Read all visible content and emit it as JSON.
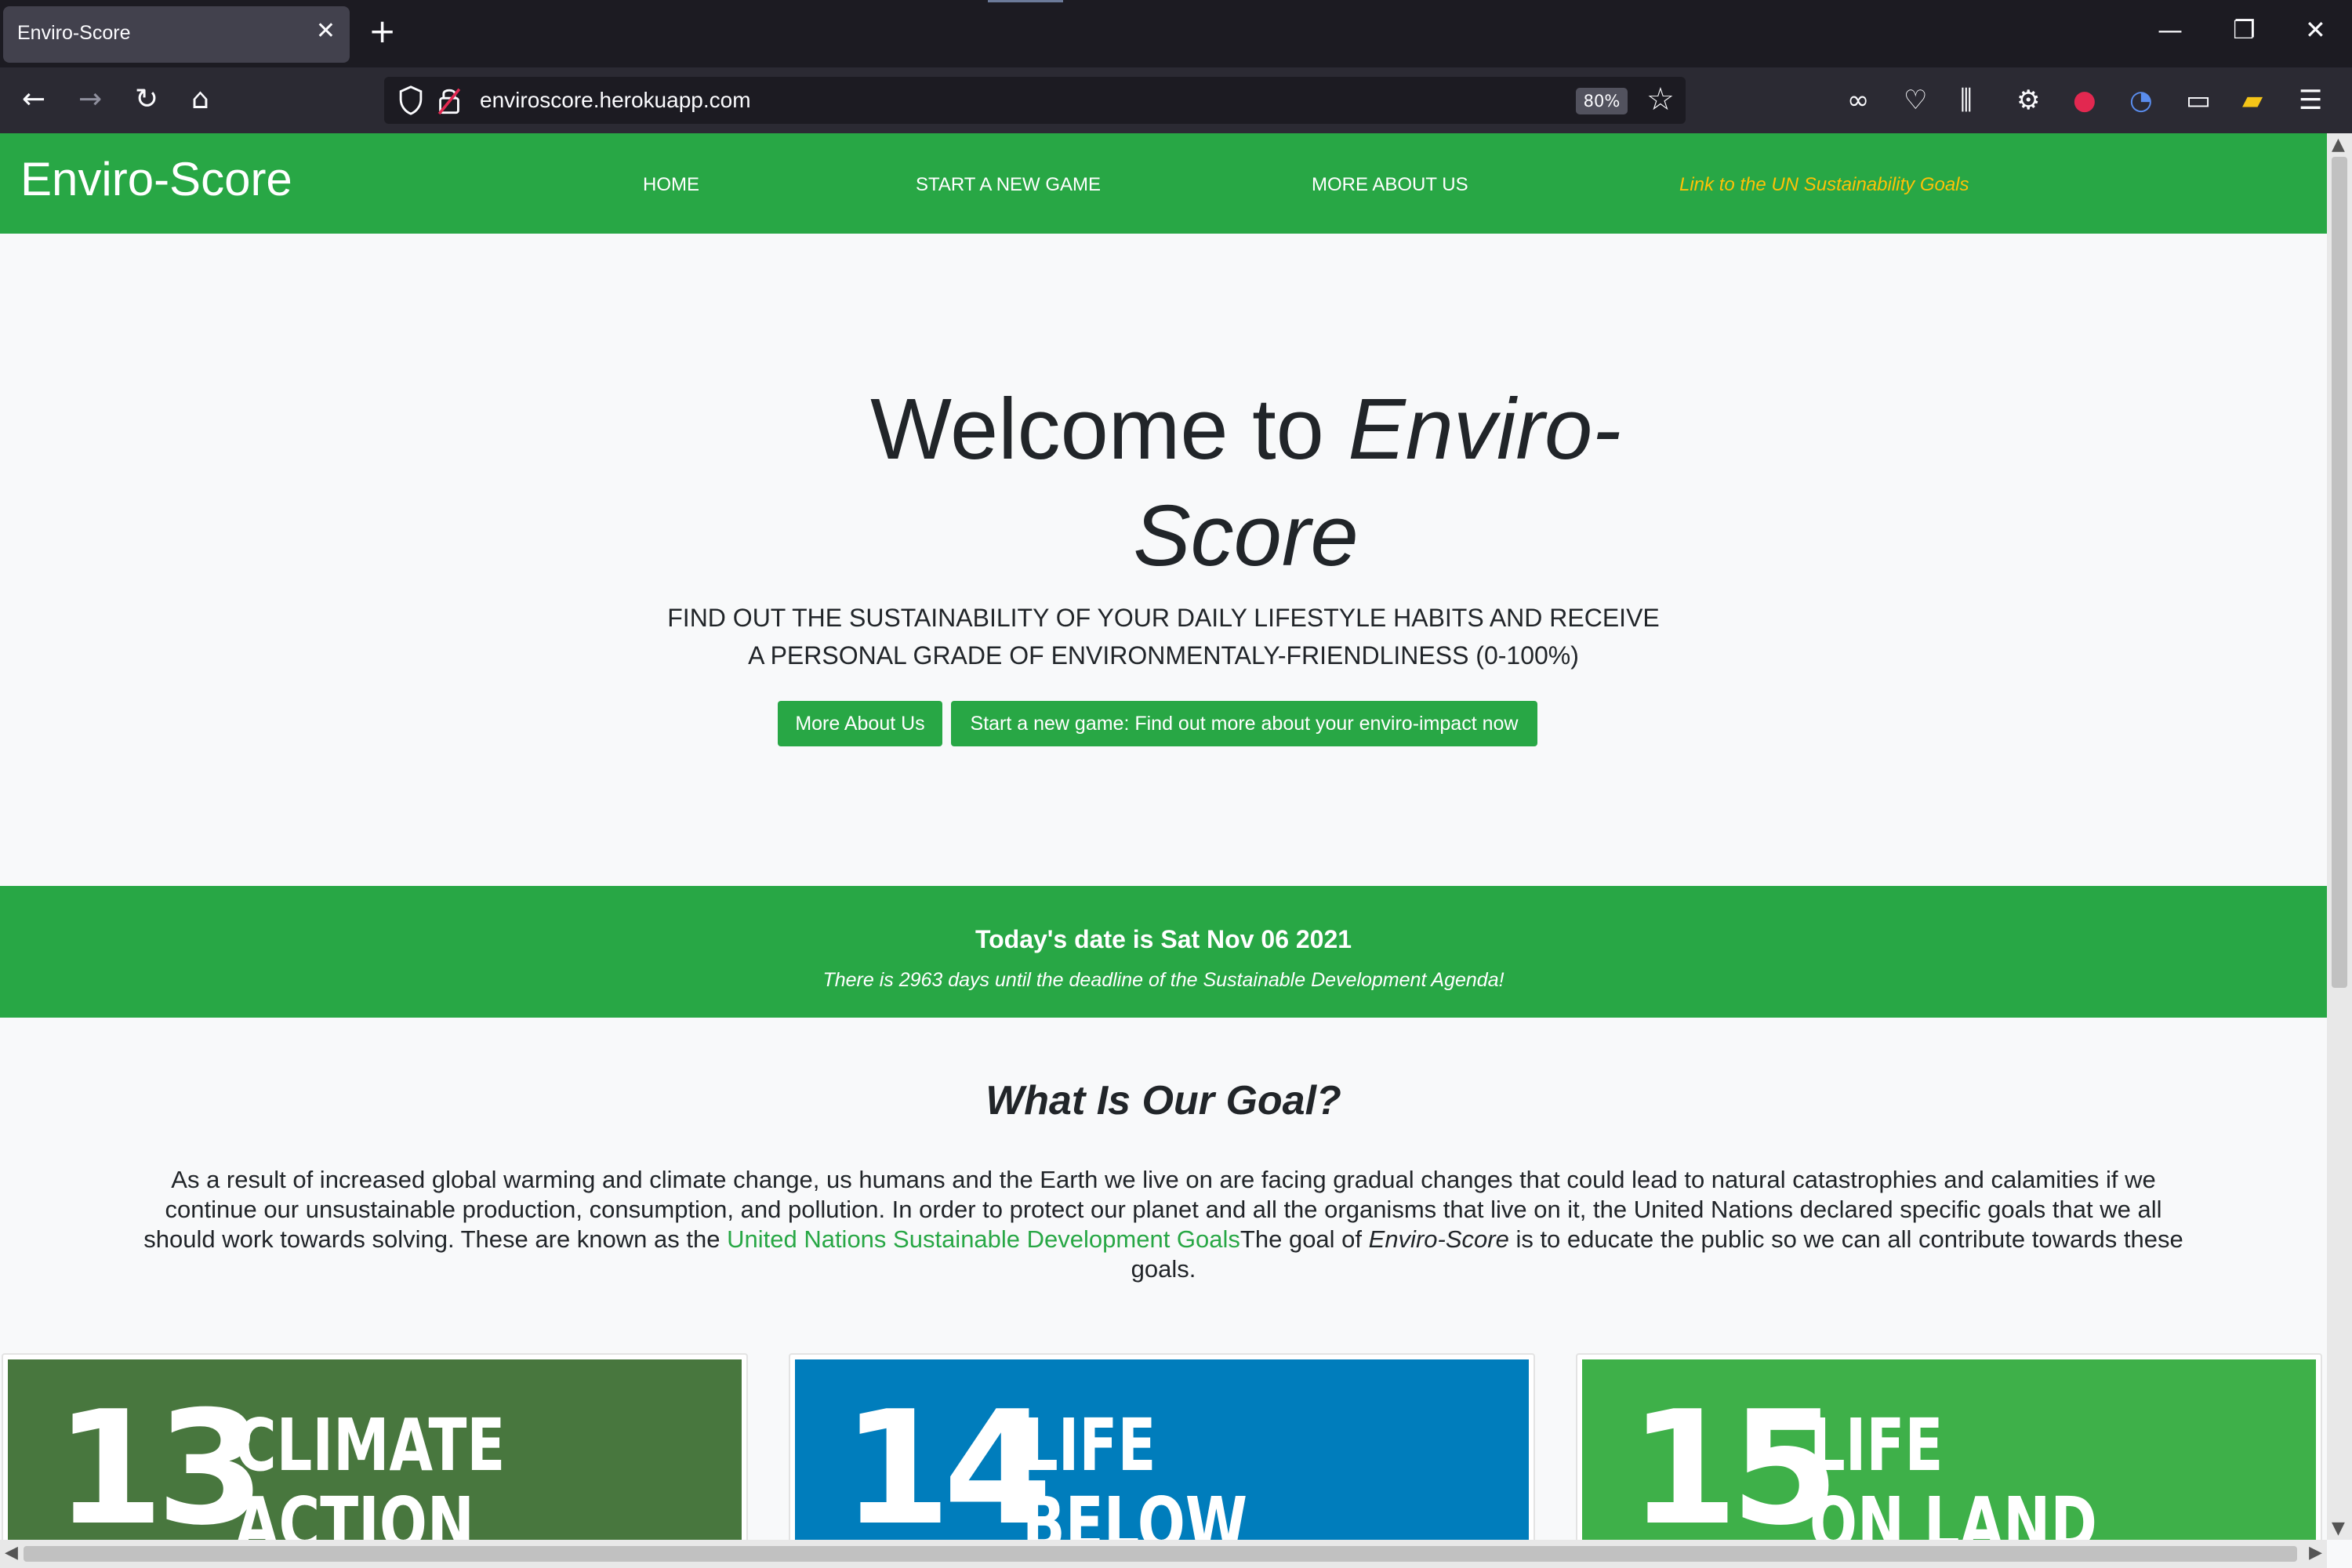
{
  "browser": {
    "tab_title": "Enviro-Score",
    "tab_close": "✕",
    "new_tab": "+",
    "url": "enviroscore.herokuapp.com",
    "zoom": "80%"
  },
  "site": {
    "brand": "Enviro-Score",
    "nav": {
      "home": "HOME",
      "start": "START A NEW GAME",
      "about": "MORE ABOUT US",
      "un_link": "Link to the UN Sustainability Goals"
    }
  },
  "hero": {
    "title_plain": "Welcome to ",
    "title_italic": "Enviro-Score",
    "subtitle_line1": "FIND OUT THE SUSTAINABILITY OF YOUR DAILY LIFESTYLE HABITS AND RECEIVE",
    "subtitle_line2": "A PERSONAL GRADE OF ENVIRONMENTALY-FRIENDLINESS (0-100%)",
    "btn_about": "More About Us",
    "btn_start": "Start a new game: Find out more about your enviro-impact now"
  },
  "date_banner": {
    "today": "Today's date is Sat Nov 06 2021",
    "countdown": "There is 2963 days until the deadline of the Sustainable Development Agenda!"
  },
  "goal": {
    "title": "What Is Our Goal?",
    "para_start": "As a result of increased global warming and climate change, us humans and the Earth we live on are facing gradual changes that could lead to natural catastrophies and calamities if we continue our unsustainable production, consumption, and pollution. In order to protect our planet and all the organisms that live on it, the United Nations declared specific goals that we all should work towards solving. These are known as the ",
    "para_link": "United Nations Sustainable Development Goals",
    "para_mid": "The goal of ",
    "para_italic": "Enviro-Score",
    "para_end": " is to educate the public so we can all contribute towards these goals."
  },
  "cards": [
    {
      "number": "13",
      "line1": "CLIMATE",
      "line2": "ACTION",
      "color": "#48773e"
    },
    {
      "number": "14",
      "line1": "LIFE",
      "line2": "BELOW WATER",
      "color": "#007dbc"
    },
    {
      "number": "15",
      "line1": "LIFE",
      "line2": "ON LAND",
      "color": "#3eb049"
    }
  ],
  "colors": {
    "brand_green": "#28a745",
    "un_link_yellow": "#ffc107"
  }
}
